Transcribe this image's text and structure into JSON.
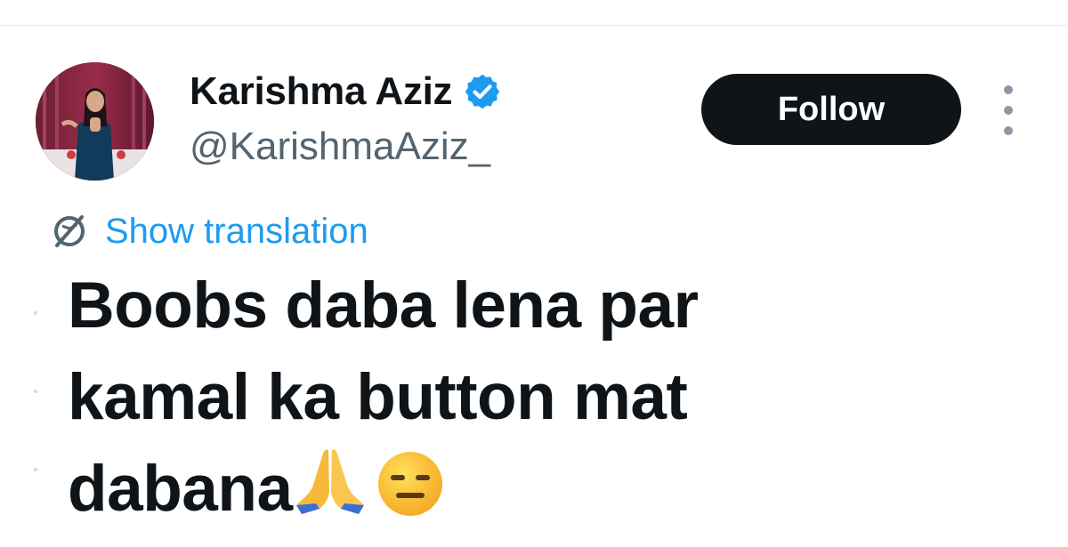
{
  "author": {
    "display_name": "Karishma Aziz",
    "handle": "@KarishmaAziz_",
    "verified": true,
    "avatar_icon": "profile-photo"
  },
  "actions": {
    "follow_label": "Follow",
    "more_icon": "more-vertical-icon"
  },
  "translation": {
    "icon": "globe-icon",
    "link_label": "Show translation"
  },
  "tweet": {
    "lines": [
      "Boobs daba lena par",
      "kamal ka button mat",
      "dabana"
    ],
    "emojis": [
      "folded-hands-emoji",
      "expressionless-face-emoji"
    ]
  },
  "colors": {
    "accent": "#1d9bf0",
    "button_bg": "#0f1419",
    "secondary_text": "#536471"
  }
}
